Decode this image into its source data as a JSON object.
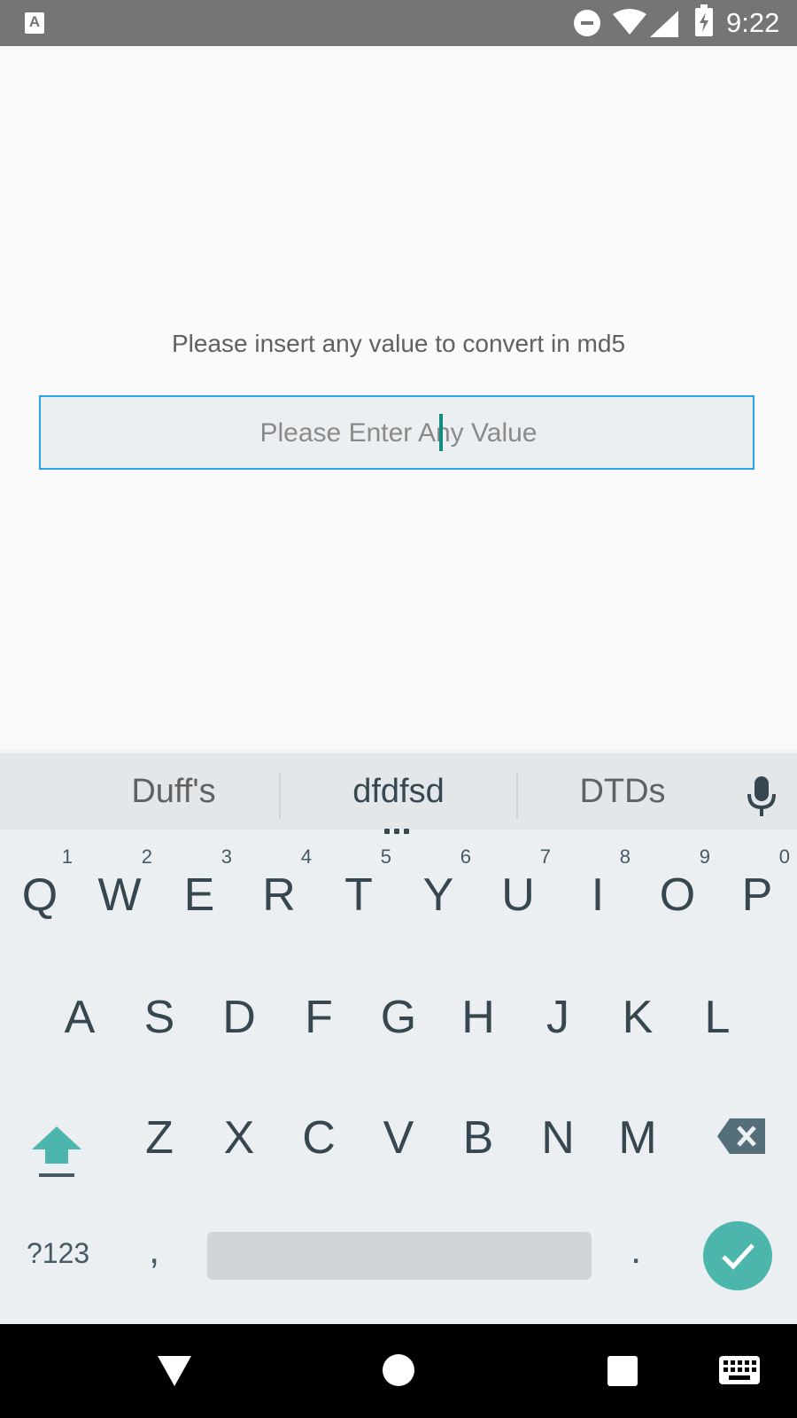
{
  "status_bar": {
    "app_badge": "A",
    "time": "9:22",
    "icons": [
      "text-app-icon",
      "do-not-disturb-icon",
      "wifi-icon",
      "cell-signal-icon",
      "battery-charging-icon"
    ]
  },
  "main": {
    "prompt": "Please insert any value to convert in md5",
    "input": {
      "value": "",
      "placeholder": "Please Enter Any Value"
    }
  },
  "keyboard": {
    "suggestions": [
      "Duff's",
      "dfdfsd",
      "DTDs"
    ],
    "row1": [
      {
        "letter": "Q",
        "hint": "1"
      },
      {
        "letter": "W",
        "hint": "2"
      },
      {
        "letter": "E",
        "hint": "3"
      },
      {
        "letter": "R",
        "hint": "4"
      },
      {
        "letter": "T",
        "hint": "5"
      },
      {
        "letter": "Y",
        "hint": "6"
      },
      {
        "letter": "U",
        "hint": "7"
      },
      {
        "letter": "I",
        "hint": "8"
      },
      {
        "letter": "O",
        "hint": "9"
      },
      {
        "letter": "P",
        "hint": "0"
      }
    ],
    "row2": [
      "A",
      "S",
      "D",
      "F",
      "G",
      "H",
      "J",
      "K",
      "L"
    ],
    "row3": [
      "Z",
      "X",
      "C",
      "V",
      "B",
      "N",
      "M"
    ],
    "symbols_label": "?123",
    "comma": ",",
    "period": ".",
    "accent_color": "#4db6ac"
  },
  "nav_bar": {
    "icons": [
      "back-icon",
      "home-icon",
      "recents-icon",
      "keyboard-switch-icon"
    ]
  }
}
